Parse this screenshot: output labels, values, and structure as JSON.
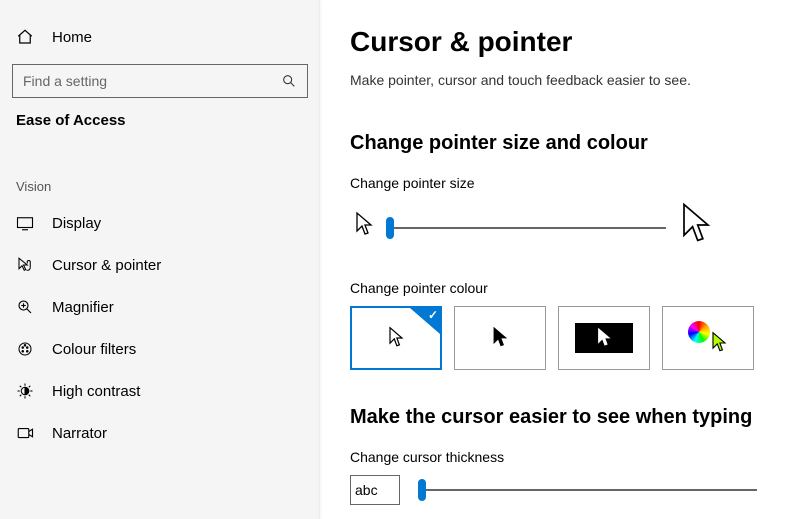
{
  "sidebar": {
    "home": "Home",
    "search_placeholder": "Find a setting",
    "category": "Ease of Access",
    "group": "Vision",
    "items": [
      {
        "label": "Display"
      },
      {
        "label": "Cursor & pointer"
      },
      {
        "label": "Magnifier"
      },
      {
        "label": "Colour filters"
      },
      {
        "label": "High contrast"
      },
      {
        "label": "Narrator"
      }
    ]
  },
  "main": {
    "title": "Cursor & pointer",
    "subtitle": "Make pointer, cursor and touch feedback easier to see.",
    "section_size_colour": "Change pointer size and colour",
    "pointer_size_label": "Change pointer size",
    "pointer_colour_label": "Change pointer colour",
    "pointer_size_value": 0,
    "colour_selected_index": 0,
    "section_typing": "Make the cursor easier to see when typing",
    "thickness_label": "Change cursor thickness",
    "thickness_preview_text": "abc",
    "thickness_value": 0
  }
}
